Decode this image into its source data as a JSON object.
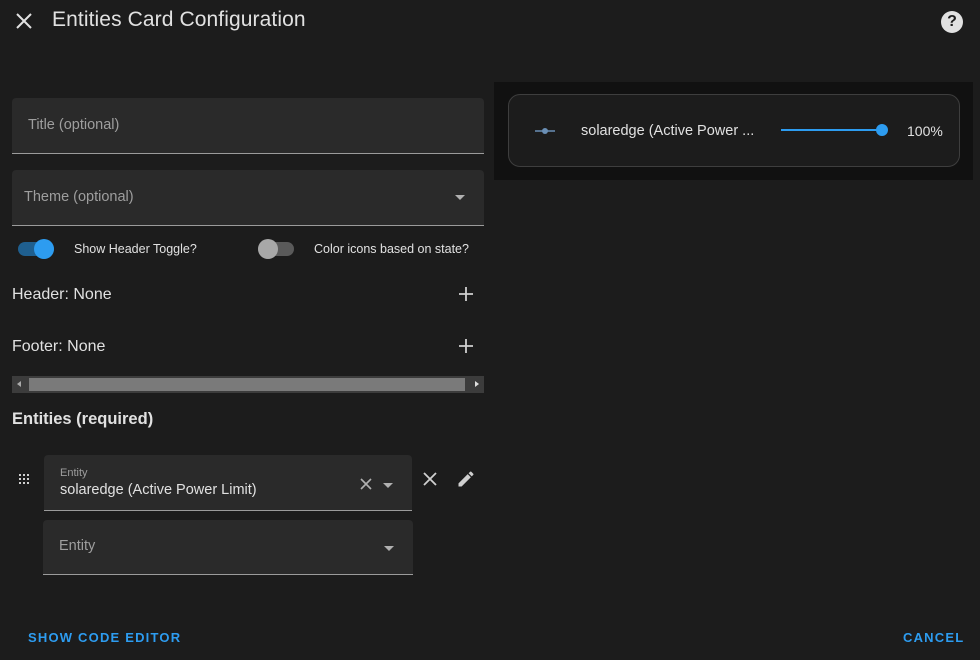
{
  "dialog": {
    "title": "Entities Card Configuration"
  },
  "form": {
    "title_field": {
      "placeholder": "Title (optional)",
      "value": ""
    },
    "theme_field": {
      "placeholder": "Theme (optional)",
      "value": ""
    },
    "show_header_toggle": {
      "label": "Show Header Toggle?",
      "checked": true
    },
    "color_icons": {
      "label": "Color icons based on state?",
      "checked": false
    },
    "header": {
      "label": "Header: None"
    },
    "footer": {
      "label": "Footer: None"
    },
    "entities_heading": "Entities (required)",
    "entity_rows": [
      {
        "label": "Entity",
        "value": "solaredge (Active Power Limit)"
      },
      {
        "label": "Entity",
        "value": ""
      }
    ]
  },
  "actions": {
    "show_code_editor": "SHOW CODE EDITOR",
    "cancel": "CANCEL"
  },
  "preview": {
    "entity_name": "solaredge (Active Power ...",
    "value_text": "100%",
    "slider_value": 100
  },
  "colors": {
    "accent": "#2d9cf0",
    "background": "#1c1c1c",
    "field_background": "#2a2a2a"
  },
  "icons": [
    "close-icon",
    "help-icon",
    "chevron-down-icon",
    "plus-icon",
    "drag-handle-icon",
    "clear-icon",
    "edit-pencil-icon",
    "entity-slider-icon"
  ]
}
